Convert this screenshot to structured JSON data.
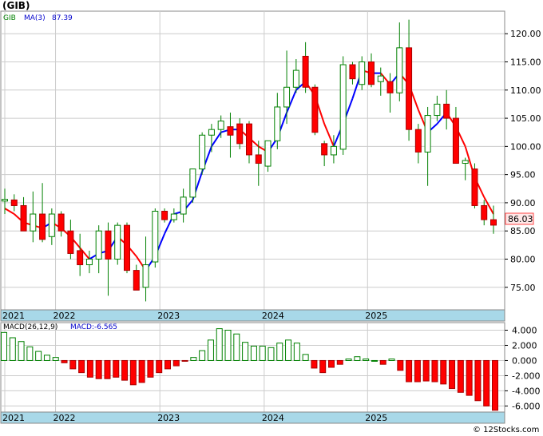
{
  "chart_data": [
    {
      "type": "candlestick",
      "title": "(GIB)",
      "ylim": [
        71,
        124
      ],
      "yticks": [
        75,
        80,
        85,
        90,
        95,
        100,
        105,
        110,
        115,
        120
      ],
      "ytick_labels": [
        "75.00",
        "80.00",
        "85.00",
        "90.00",
        "95.00",
        "100.00",
        "105.00",
        "110.00",
        "115.00",
        "120.00"
      ],
      "year_labels": [
        "2021",
        "2022",
        "2023",
        "2024",
        "2025"
      ],
      "last_price": "86.03",
      "legend": [
        {
          "label": "GIB",
          "color": "#008000"
        },
        {
          "label": "MA(3)",
          "color": "#0000cc"
        },
        {
          "label": "87.39",
          "color": "#0000cc"
        }
      ],
      "colors": {
        "up": "#ffffff",
        "down": "#ff0000",
        "wick": "#008000",
        "ma_up": "#0000ff",
        "ma_down": "#ff0000",
        "grid": "#cccccc",
        "axis_band": "#a8d8e8"
      },
      "candles": [
        [
          90.3,
          92.5,
          88.0,
          90.6
        ],
        [
          90.5,
          91.5,
          88.5,
          89.5
        ],
        [
          89.5,
          91.0,
          85.0,
          85.0
        ],
        [
          85.0,
          92.0,
          83.0,
          88.0
        ],
        [
          88.0,
          93.5,
          83.0,
          83.5
        ],
        [
          84.0,
          89.0,
          82.5,
          88.0
        ],
        [
          88.0,
          88.5,
          84.0,
          85.0
        ],
        [
          85.0,
          87.0,
          80.0,
          81.0
        ],
        [
          81.5,
          84.5,
          77.0,
          79.0
        ],
        [
          79.0,
          81.5,
          77.5,
          80.0
        ],
        [
          80.0,
          86.0,
          77.5,
          85.0
        ],
        [
          85.0,
          86.5,
          73.5,
          80.0
        ],
        [
          80.0,
          86.5,
          79.0,
          86.0
        ],
        [
          86.0,
          86.5,
          77.5,
          78.0
        ],
        [
          78.0,
          79.0,
          74.5,
          74.5
        ],
        [
          75.0,
          84.0,
          72.5,
          79.0
        ],
        [
          79.5,
          89.0,
          78.5,
          88.5
        ],
        [
          88.5,
          89.0,
          86.5,
          87.0
        ],
        [
          87.0,
          89.0,
          86.5,
          88.0
        ],
        [
          88.0,
          92.5,
          86.5,
          91.0
        ],
        [
          91.0,
          96.0,
          90.0,
          96.0
        ],
        [
          96.0,
          102.5,
          95.0,
          102.0
        ],
        [
          102.0,
          104.0,
          99.0,
          103.0
        ],
        [
          103.0,
          105.5,
          101.5,
          104.5
        ],
        [
          103.5,
          106.0,
          98.0,
          102.0
        ],
        [
          104.0,
          105.0,
          99.5,
          100.5
        ],
        [
          104.0,
          104.5,
          97.0,
          98.5
        ],
        [
          98.5,
          101.0,
          93.0,
          97.0
        ],
        [
          96.5,
          101.0,
          95.5,
          101.0
        ],
        [
          101.0,
          109.5,
          99.5,
          107.0
        ],
        [
          107.0,
          117.0,
          104.0,
          110.5
        ],
        [
          110.5,
          115.5,
          109.5,
          113.5
        ],
        [
          116.0,
          118.5,
          109.5,
          110.5
        ],
        [
          110.5,
          111.0,
          102.0,
          102.5
        ],
        [
          100.5,
          101.0,
          96.5,
          98.5
        ],
        [
          98.5,
          102.0,
          97.0,
          100.0
        ],
        [
          99.5,
          116.0,
          98.5,
          114.5
        ],
        [
          114.5,
          115.0,
          111.0,
          112.0
        ],
        [
          111.0,
          116.0,
          110.0,
          115.0
        ],
        [
          115.0,
          116.5,
          110.5,
          111.0
        ],
        [
          111.5,
          114.0,
          109.0,
          112.5
        ],
        [
          111.5,
          113.0,
          106.0,
          109.5
        ],
        [
          109.5,
          122.0,
          108.0,
          117.5
        ],
        [
          117.5,
          122.5,
          101.0,
          103.0
        ],
        [
          103.0,
          104.0,
          97.0,
          99.0
        ],
        [
          99.0,
          107.0,
          93.0,
          105.5
        ],
        [
          105.5,
          109.0,
          104.5,
          107.5
        ],
        [
          107.5,
          110.0,
          103.0,
          105.0
        ],
        [
          105.0,
          107.0,
          97.0,
          97.0
        ],
        [
          97.0,
          98.0,
          94.0,
          97.5
        ],
        [
          96.0,
          97.0,
          89.0,
          89.5
        ],
        [
          89.5,
          90.5,
          86.0,
          87.0
        ],
        [
          87.0,
          89.5,
          84.5,
          86.03
        ]
      ],
      "ma3": [
        89.0,
        88.0,
        86.5,
        86.0,
        85.5,
        86.5,
        85.5,
        84.0,
        82.0,
        80.0,
        81.0,
        81.5,
        84.0,
        82.5,
        80.5,
        78.0,
        80.5,
        84.5,
        88.0,
        88.5,
        90.5,
        95.5,
        100.0,
        102.5,
        103.0,
        103.0,
        101.5,
        100.0,
        99.0,
        101.5,
        106.0,
        110.0,
        111.5,
        109.0,
        104.0,
        100.0,
        104.0,
        108.5,
        113.5,
        113.0,
        113.0,
        111.0,
        113.0,
        111.0,
        106.5,
        102.5,
        104.0,
        106.0,
        103.5,
        100.0,
        94.5,
        91.0,
        88.0
      ]
    },
    {
      "type": "bar",
      "title": "MACD(26,12,9)",
      "legend": [
        {
          "label": "MACD(26,12,9)",
          "color": "#000000"
        },
        {
          "label": "MACD:-6.565",
          "color": "#0000cc"
        }
      ],
      "ylim": [
        -6.8,
        5.0
      ],
      "yticks": [
        4,
        2,
        0,
        -2,
        -4,
        -6
      ],
      "ytick_labels": [
        "4.000",
        "2.000",
        "0.000",
        "-2.000",
        "-4.000",
        "-6.000"
      ],
      "year_labels": [
        "2021",
        "2022",
        "2023",
        "2024",
        "2025"
      ],
      "colors": {
        "positive": "#ffffff",
        "positive_border": "#008000",
        "negative": "#ff0000"
      },
      "values": [
        3.7,
        3.0,
        2.5,
        1.8,
        1.2,
        0.7,
        0.4,
        -0.3,
        -1.1,
        -1.6,
        -2.2,
        -2.4,
        -2.4,
        -2.2,
        -2.6,
        -3.2,
        -2.9,
        -2.2,
        -1.6,
        -1.1,
        -0.7,
        -0.1,
        0.4,
        1.3,
        2.7,
        4.2,
        4.0,
        3.5,
        2.4,
        1.9,
        1.9,
        1.7,
        2.3,
        2.7,
        2.3,
        0.8,
        -1.0,
        -1.6,
        -0.9,
        -0.5,
        0.2,
        0.5,
        0.2,
        0.0,
        -0.5,
        0.2,
        -1.3,
        -2.8,
        -2.8,
        -2.7,
        -2.8,
        -3.1,
        -3.7,
        -4.2,
        -4.6,
        -5.3,
        -6.0,
        -6.565
      ]
    }
  ],
  "credit": "© 12Stocks.com"
}
